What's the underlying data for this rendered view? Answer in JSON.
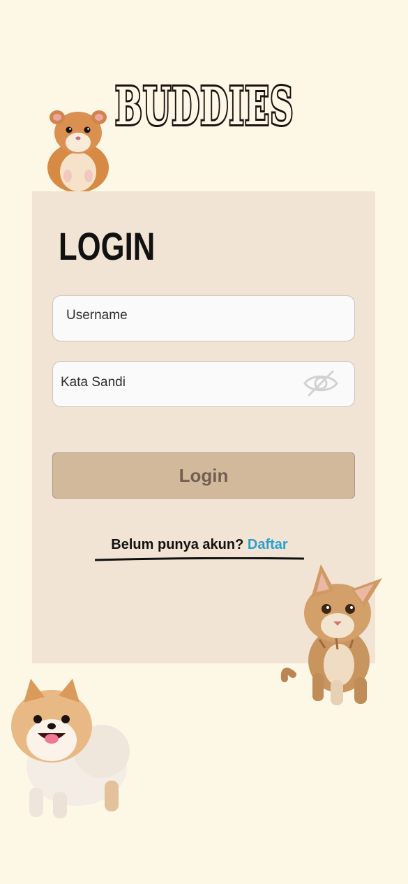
{
  "app": {
    "brand": "BUDDIES"
  },
  "login": {
    "title": "LOGIN",
    "username_placeholder": "Username",
    "password_placeholder": "Kata Sandi",
    "submit_label": "Login",
    "signup_prompt": "Belum punya akun?",
    "signup_link": "Daftar"
  },
  "icons": {
    "password_toggle": "eye-slash-icon"
  },
  "colors": {
    "background": "#fdf7e6",
    "card": "#f1e4d4",
    "button": "#d2b99c",
    "link": "#2a9fd0"
  }
}
